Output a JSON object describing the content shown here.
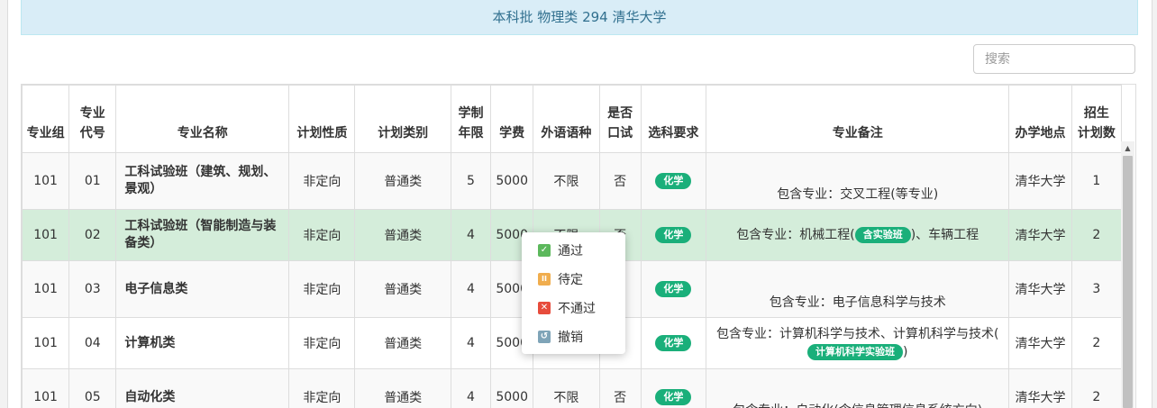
{
  "header": {
    "title": "本科批 物理类 294 清华大学"
  },
  "search": {
    "placeholder": "搜索"
  },
  "table": {
    "columns": [
      [
        "专业组"
      ],
      [
        "专业",
        "代号"
      ],
      [
        "专业名称"
      ],
      [
        "计划性质"
      ],
      [
        "计划类别"
      ],
      [
        "学制",
        "年限"
      ],
      [
        "学费"
      ],
      [
        "外语语种"
      ],
      [
        "是否",
        "口试"
      ],
      [
        "选科要求"
      ],
      [
        "专业备注"
      ],
      [
        "办学地点"
      ],
      [
        "招生",
        "计划数"
      ]
    ],
    "rows": [
      {
        "group": "101",
        "code": "01",
        "name": "工科试验班（建筑、规划、景观）",
        "nature": "非定向",
        "category": "普通类",
        "years": "5",
        "fee": "5000",
        "language": "不限",
        "oral": "否",
        "subject": "化学",
        "remark": [
          "包含专业：交叉工程(等专业)"
        ],
        "location": "清华大学",
        "quota": "1"
      },
      {
        "group": "101",
        "code": "02",
        "name": "工科试验班（智能制造与装备类）",
        "nature": "非定向",
        "category": "普通类",
        "years": "4",
        "fee": "5000",
        "language": "不限",
        "oral": "否",
        "subject": "化学",
        "remark": [
          "包含专业：机械工程(",
          "含实验班",
          ")、车辆工程"
        ],
        "location": "清华大学",
        "quota": "2",
        "selected": true
      },
      {
        "group": "101",
        "code": "03",
        "name": "电子信息类",
        "nature": "非定向",
        "category": "普通类",
        "years": "4",
        "fee": "5000",
        "language": "",
        "oral": "",
        "subject": "化学",
        "remark": [
          "包含专业：电子信息科学与技术"
        ],
        "location": "清华大学",
        "quota": "3"
      },
      {
        "group": "101",
        "code": "04",
        "name": "计算机类",
        "nature": "非定向",
        "category": "普通类",
        "years": "4",
        "fee": "5000",
        "language": "",
        "oral": "",
        "subject": "化学",
        "remark": [
          "包含专业：计算机科学与技术、计算机科学与技术(",
          "计算机科学实验班",
          ")"
        ],
        "location": "清华大学",
        "quota": "2"
      },
      {
        "group": "101",
        "code": "05",
        "name": "自动化类",
        "nature": "非定向",
        "category": "普通类",
        "years": "4",
        "fee": "5000",
        "language": "不限",
        "oral": "否",
        "subject": "化学",
        "remark": [
          "包含专业：自动化(含信息管理信息系统方向)"
        ],
        "location": "清华大学",
        "quota": "2"
      }
    ]
  },
  "context_menu": {
    "items": [
      {
        "label": "通过",
        "icon": "check-icon",
        "color": "#5cb85c"
      },
      {
        "label": "待定",
        "icon": "pause-icon",
        "color": "#f0ad4e"
      },
      {
        "label": "不通过",
        "icon": "close-icon",
        "color": "#e74c3c"
      },
      {
        "label": "撤销",
        "icon": "undo-icon",
        "color": "#7fa4b8"
      }
    ]
  }
}
